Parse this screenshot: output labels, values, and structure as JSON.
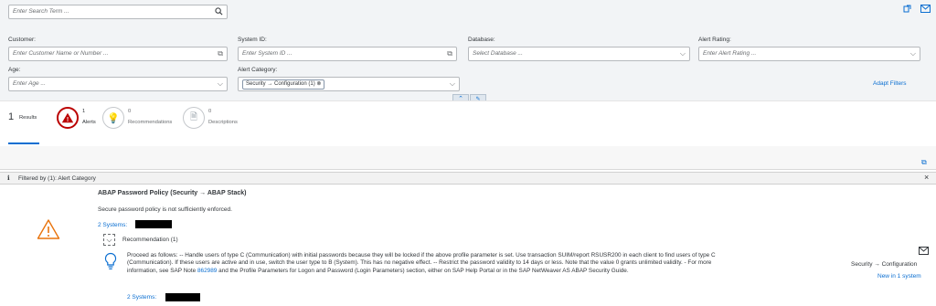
{
  "search": {
    "placeholder": "Enter Search Term ..."
  },
  "filters": {
    "customer": {
      "label": "Customer:",
      "placeholder": "Enter Customer Name or Number ..."
    },
    "system_id": {
      "label": "System ID:",
      "placeholder": "Enter System ID ..."
    },
    "database": {
      "label": "Database:",
      "placeholder": "Select Database ..."
    },
    "alert_rating": {
      "label": "Alert Rating:",
      "placeholder": "Enter Alert Rating ..."
    },
    "age": {
      "label": "Age:",
      "placeholder": "Enter Age ..."
    },
    "alert_category": {
      "label": "Alert Category:",
      "token": "Security → Configuration (1)"
    },
    "adapt_label": "Adapt Filters"
  },
  "results": {
    "count": "1",
    "label": "Results",
    "alerts_count": "1",
    "alerts_label": "Alerts",
    "recommendations_count": "0",
    "recommendations_label": "Recommendations",
    "descriptions_count": "0",
    "descriptions_label": "Descriptions"
  },
  "filter_info": {
    "text": "Filtered by (1): Alert Category",
    "close": "×"
  },
  "alert": {
    "title": "ABAP Password Policy (Security → ABAP Stack)",
    "description": "Secure password policy is not sufficiently enforced.",
    "systems_link": "2 Systems:",
    "recommendation_header": "Recommendation (1)",
    "recommendation_text": "Proceed as follows: -- Handle users of type C (Communication) with initial passwords because they will be locked if the above profile parameter is set. Use transaction SUIM/report RSUSR200 in each client to find users of type C (Communication). If these users are active and in use, switch the user type to B (System). This has no negative effect. -- Restrict the password validity to 14 days or less. Note that the value 0 grants unlimited validity. - For more information, see SAP Note",
    "note_number": "862989",
    "recommendation_text_2": "and the Profile Parameters for Logon and Password (Login Parameters) section, either on SAP Help Portal or in the SAP NetWeaver AS ABAP Security Guide.",
    "systems_link_2": "2 Systems:",
    "category": "Security → Configuration",
    "new_in": "New in 1 system"
  },
  "colors": {
    "accent": "#0a6ed1",
    "alert_red": "#bb0000",
    "warning": "#e9730c"
  }
}
